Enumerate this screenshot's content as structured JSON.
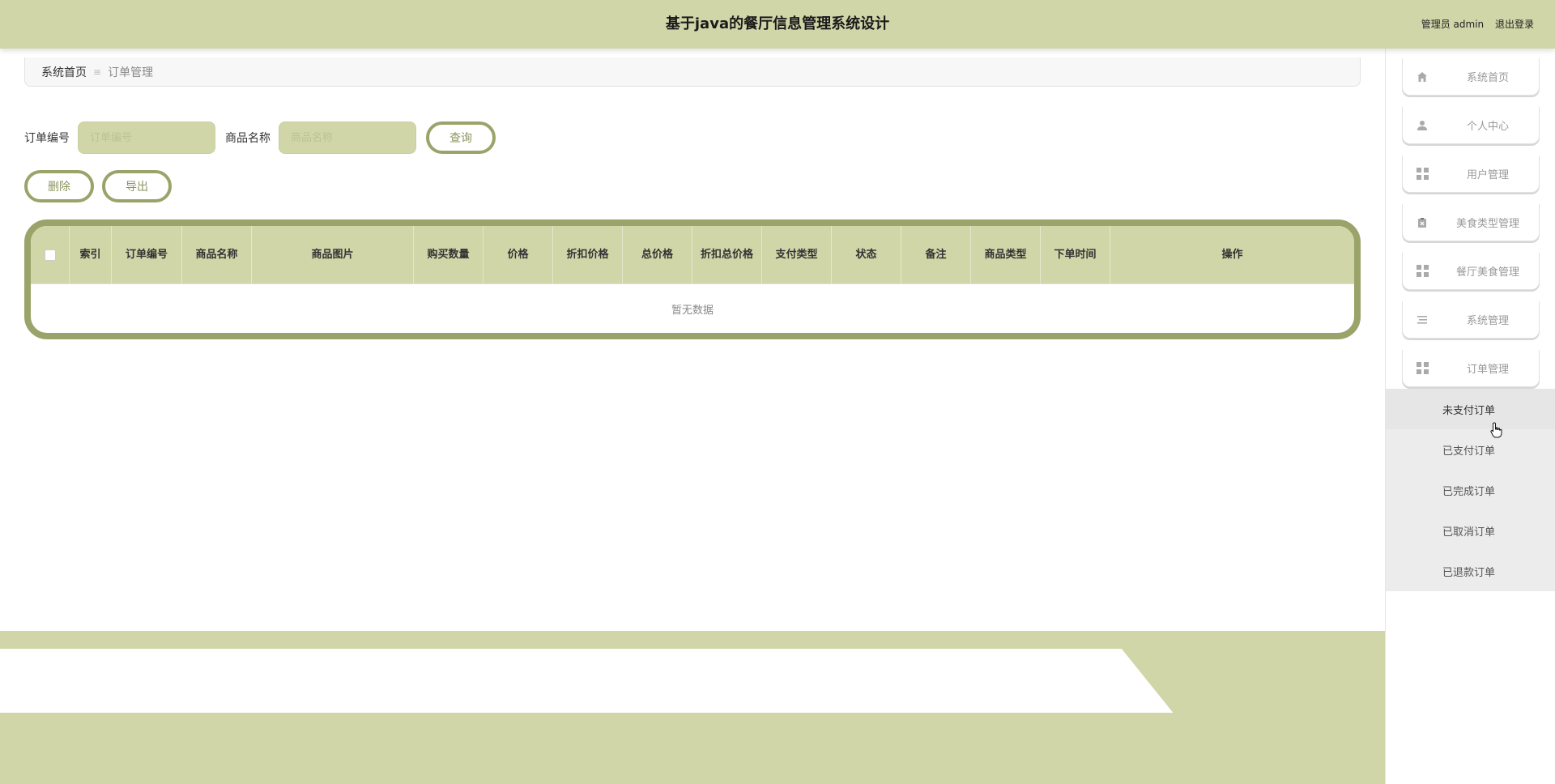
{
  "header": {
    "title": "基于java的餐厅信息管理系统设计",
    "user_label": "管理员 admin",
    "logout_label": "退出登录"
  },
  "breadcrumb": {
    "home": "系统首页",
    "separator": "≡",
    "current": "订单管理"
  },
  "search": {
    "order_no_label": "订单编号",
    "order_no_placeholder": "订单编号",
    "product_label": "商品名称",
    "product_placeholder": "商品名称",
    "query_button": "查询"
  },
  "actions": {
    "delete_button": "删除",
    "export_button": "导出"
  },
  "table": {
    "columns": [
      "索引",
      "订单编号",
      "商品名称",
      "商品图片",
      "购买数量",
      "价格",
      "折扣价格",
      "总价格",
      "折扣总价格",
      "支付类型",
      "状态",
      "备注",
      "商品类型",
      "下单时间",
      "操作"
    ],
    "empty_text": "暂无数据"
  },
  "sidebar": {
    "items": [
      {
        "label": "系统首页",
        "icon": "home-icon"
      },
      {
        "label": "个人中心",
        "icon": "user-icon"
      },
      {
        "label": "用户管理",
        "icon": "grid-icon"
      },
      {
        "label": "美食类型管理",
        "icon": "clipboard-icon"
      },
      {
        "label": "餐厅美食管理",
        "icon": "grid-icon"
      },
      {
        "label": "系统管理",
        "icon": "list-icon"
      },
      {
        "label": "订单管理",
        "icon": "grid-icon"
      }
    ],
    "submenu": [
      "未支付订单",
      "已支付订单",
      "已完成订单",
      "已取消订单",
      "已退款订单"
    ]
  },
  "colors": {
    "accent": "#d0d6a8",
    "border_accent": "#9aa46a"
  }
}
